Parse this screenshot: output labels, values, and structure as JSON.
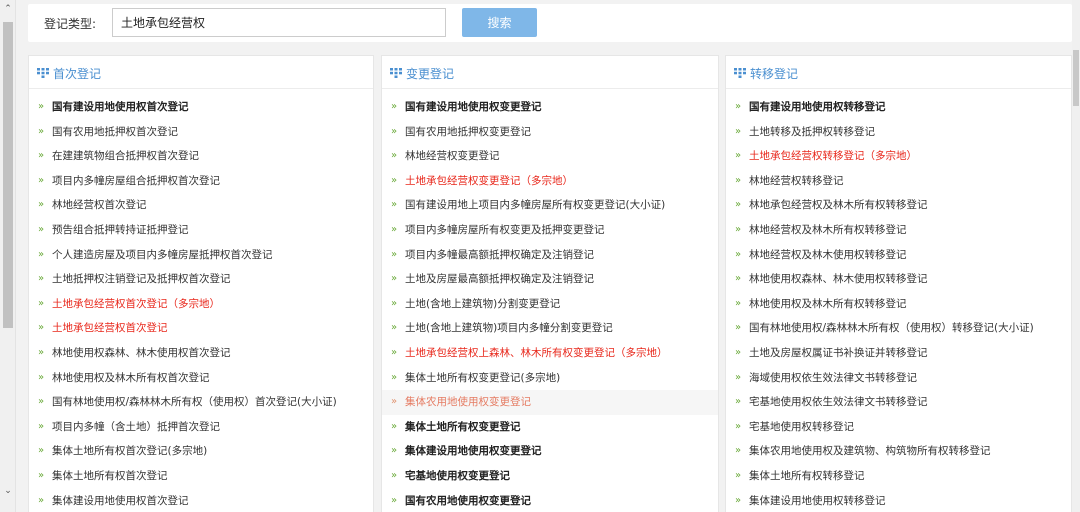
{
  "search": {
    "label": "登记类型:",
    "value": "土地承包经营权",
    "button_label": "搜索"
  },
  "panels": [
    {
      "title": "首次登记",
      "items": [
        {
          "label": "国有建设用地使用权首次登记",
          "style": "bold"
        },
        {
          "label": "国有农用地抵押权首次登记",
          "style": "normal"
        },
        {
          "label": "在建建筑物组合抵押权首次登记",
          "style": "normal"
        },
        {
          "label": "项目内多幢房屋组合抵押权首次登记",
          "style": "normal"
        },
        {
          "label": "林地经营权首次登记",
          "style": "normal"
        },
        {
          "label": "预告组合抵押转持证抵押登记",
          "style": "normal"
        },
        {
          "label": "个人建造房屋及项目内多幢房屋抵押权首次登记",
          "style": "normal"
        },
        {
          "label": "土地抵押权注销登记及抵押权首次登记",
          "style": "normal"
        },
        {
          "label": "土地承包经营权首次登记（多宗地）",
          "style": "red"
        },
        {
          "label": "土地承包经营权首次登记",
          "style": "red"
        },
        {
          "label": "林地使用权森林、林木使用权首次登记",
          "style": "normal"
        },
        {
          "label": "林地使用权及林木所有权首次登记",
          "style": "normal"
        },
        {
          "label": "国有林地使用权/森林林木所有权（使用权）首次登记(大小证)",
          "style": "normal"
        },
        {
          "label": "项目内多幢（含土地）抵押首次登记",
          "style": "normal"
        },
        {
          "label": "集体土地所有权首次登记(多宗地)",
          "style": "normal"
        },
        {
          "label": "集体土地所有权首次登记",
          "style": "normal"
        },
        {
          "label": "集体建设用地使用权首次登记",
          "style": "normal"
        }
      ]
    },
    {
      "title": "变更登记",
      "items": [
        {
          "label": "国有建设用地使用权变更登记",
          "style": "bold"
        },
        {
          "label": "国有农用地抵押权变更登记",
          "style": "normal"
        },
        {
          "label": "林地经营权变更登记",
          "style": "normal"
        },
        {
          "label": "土地承包经营权变更登记（多宗地）",
          "style": "red"
        },
        {
          "label": "国有建设用地上项目内多幢房屋所有权变更登记(大小证)",
          "style": "normal"
        },
        {
          "label": "项目内多幢房屋所有权变更及抵押变更登记",
          "style": "normal"
        },
        {
          "label": "项目内多幢最高额抵押权确定及注销登记",
          "style": "normal"
        },
        {
          "label": "土地及房屋最高额抵押权确定及注销登记",
          "style": "normal"
        },
        {
          "label": "土地(含地上建筑物)分割变更登记",
          "style": "normal"
        },
        {
          "label": "土地(含地上建筑物)项目内多幢分割变更登记",
          "style": "normal"
        },
        {
          "label": "土地承包经营权上森林、林木所有权变更登记（多宗地）",
          "style": "red"
        },
        {
          "label": "集体土地所有权变更登记(多宗地)",
          "style": "normal"
        },
        {
          "label": "集体农用地使用权变更登记",
          "style": "muted"
        },
        {
          "label": "集体土地所有权变更登记",
          "style": "bold"
        },
        {
          "label": "集体建设用地使用权变更登记",
          "style": "bold"
        },
        {
          "label": "宅基地使用权变更登记",
          "style": "bold"
        },
        {
          "label": "国有农用地使用权变更登记",
          "style": "bold"
        }
      ]
    },
    {
      "title": "转移登记",
      "items": [
        {
          "label": "国有建设用地使用权转移登记",
          "style": "bold"
        },
        {
          "label": "土地转移及抵押权转移登记",
          "style": "normal"
        },
        {
          "label": "土地承包经营权转移登记（多宗地）",
          "style": "red"
        },
        {
          "label": "林地经营权转移登记",
          "style": "normal"
        },
        {
          "label": "林地承包经营权及林木所有权转移登记",
          "style": "normal"
        },
        {
          "label": "林地经营权及林木所有权转移登记",
          "style": "normal"
        },
        {
          "label": "林地经营权及林木使用权转移登记",
          "style": "normal"
        },
        {
          "label": "林地使用权森林、林木使用权转移登记",
          "style": "normal"
        },
        {
          "label": "林地使用权及林木所有权转移登记",
          "style": "normal"
        },
        {
          "label": "国有林地使用权/森林林木所有权（使用权）转移登记(大小证)",
          "style": "normal"
        },
        {
          "label": "土地及房屋权属证书补换证并转移登记",
          "style": "normal"
        },
        {
          "label": "海域使用权依生效法律文书转移登记",
          "style": "normal"
        },
        {
          "label": "宅基地使用权依生效法律文书转移登记",
          "style": "normal"
        },
        {
          "label": "宅基地使用权转移登记",
          "style": "normal"
        },
        {
          "label": "集体农用地使用权及建筑物、构筑物所有权转移登记",
          "style": "normal"
        },
        {
          "label": "集体土地所有权转移登记",
          "style": "normal"
        },
        {
          "label": "集体建设用地使用权转移登记",
          "style": "normal"
        }
      ]
    }
  ],
  "icons": {
    "panel_icon": "grid-icon",
    "item_icon": "double-chevron-right-icon",
    "scroll_up": "chevron-up-icon",
    "scroll_down": "chevron-down-icon"
  },
  "colors": {
    "accent": "#4a8fd0",
    "button": "#7fb7e8",
    "highlight_red": "#e8271b",
    "chevron_green": "#6aaa3a"
  }
}
